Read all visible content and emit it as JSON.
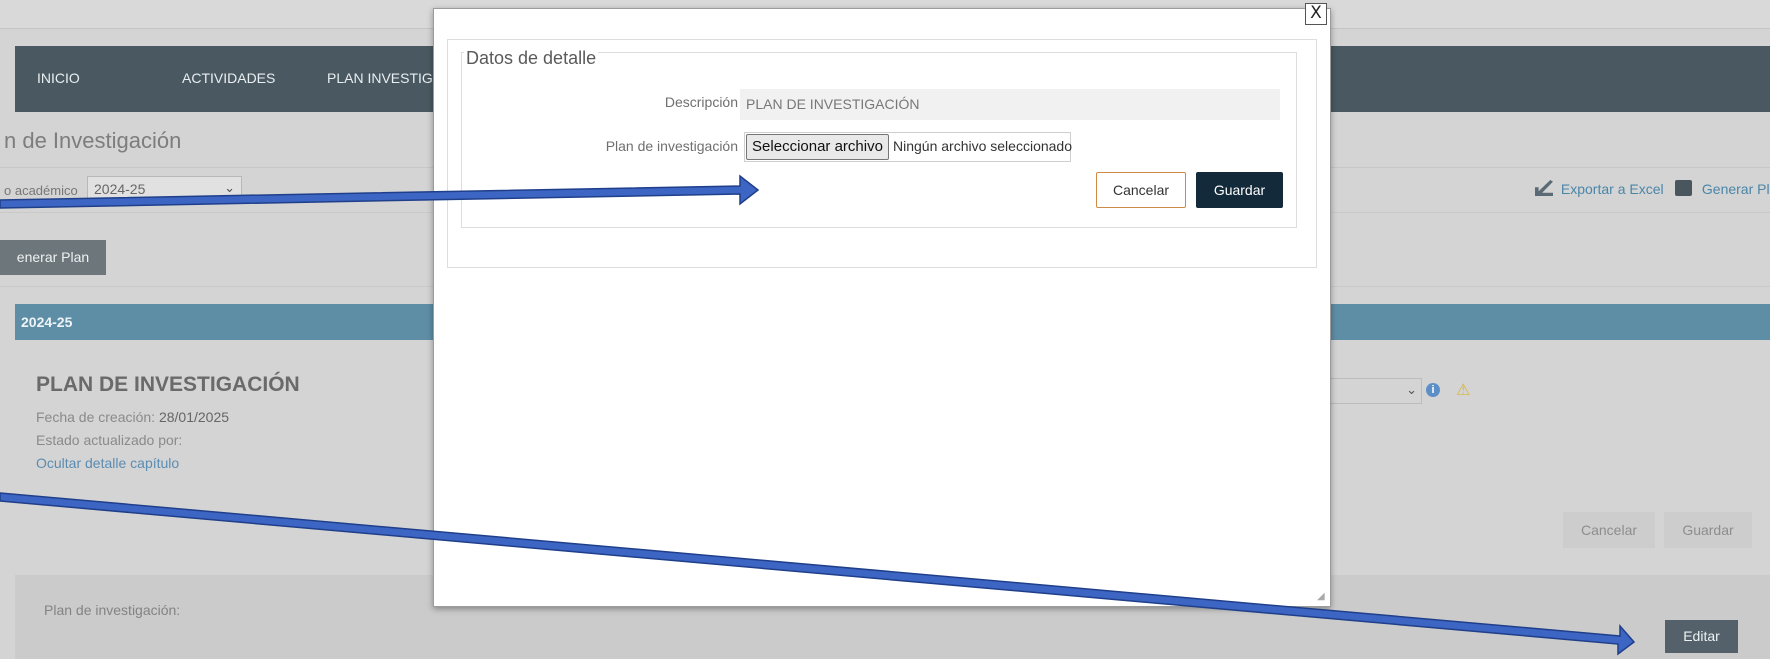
{
  "nav": {
    "items": [
      "INICIO",
      "ACTIVIDADES",
      "PLAN INVESTIGACI"
    ]
  },
  "page": {
    "title": "n de Investigación",
    "academic_label": "o académico",
    "academic_year": "2024-25",
    "export_excel": "Exportar a Excel",
    "generate_pdf": "Generar Pl",
    "generate_plan_button": "enerar Plan"
  },
  "year_bar": {
    "label": "2024-25"
  },
  "plan": {
    "title": "PLAN DE INVESTIGACIÓN",
    "created_label": "Fecha de creación:",
    "created_value": "28/01/2025",
    "status_label": "Estado actualizado por:",
    "hide_detail_link": "Ocultar detalle capítulo"
  },
  "background_actions": {
    "cancel": "Cancelar",
    "save": "Guardar"
  },
  "bottom": {
    "label": "Plan de investigación:",
    "edit_button": "Editar"
  },
  "modal": {
    "close": "X",
    "legend": "Datos de detalle",
    "description_label": "Descripción",
    "description_value": "PLAN DE INVESTIGACIÓN",
    "plan_label": "Plan de investigación",
    "file_button": "Seleccionar archivo",
    "file_status": "Ningún archivo seleccionado",
    "cancel": "Cancelar",
    "save": "Guardar"
  },
  "colors": {
    "navbar": "#4a5961",
    "year_bar": "#5e8ea6",
    "arrow_fill": "#3d65c4",
    "save_button": "#132a3b",
    "cancel_border": "#d08a48"
  },
  "icons": [
    "chevron-down-icon",
    "excel-export-icon",
    "printer-icon",
    "info-icon",
    "warning-icon",
    "close-icon",
    "resize-grip-icon"
  ]
}
